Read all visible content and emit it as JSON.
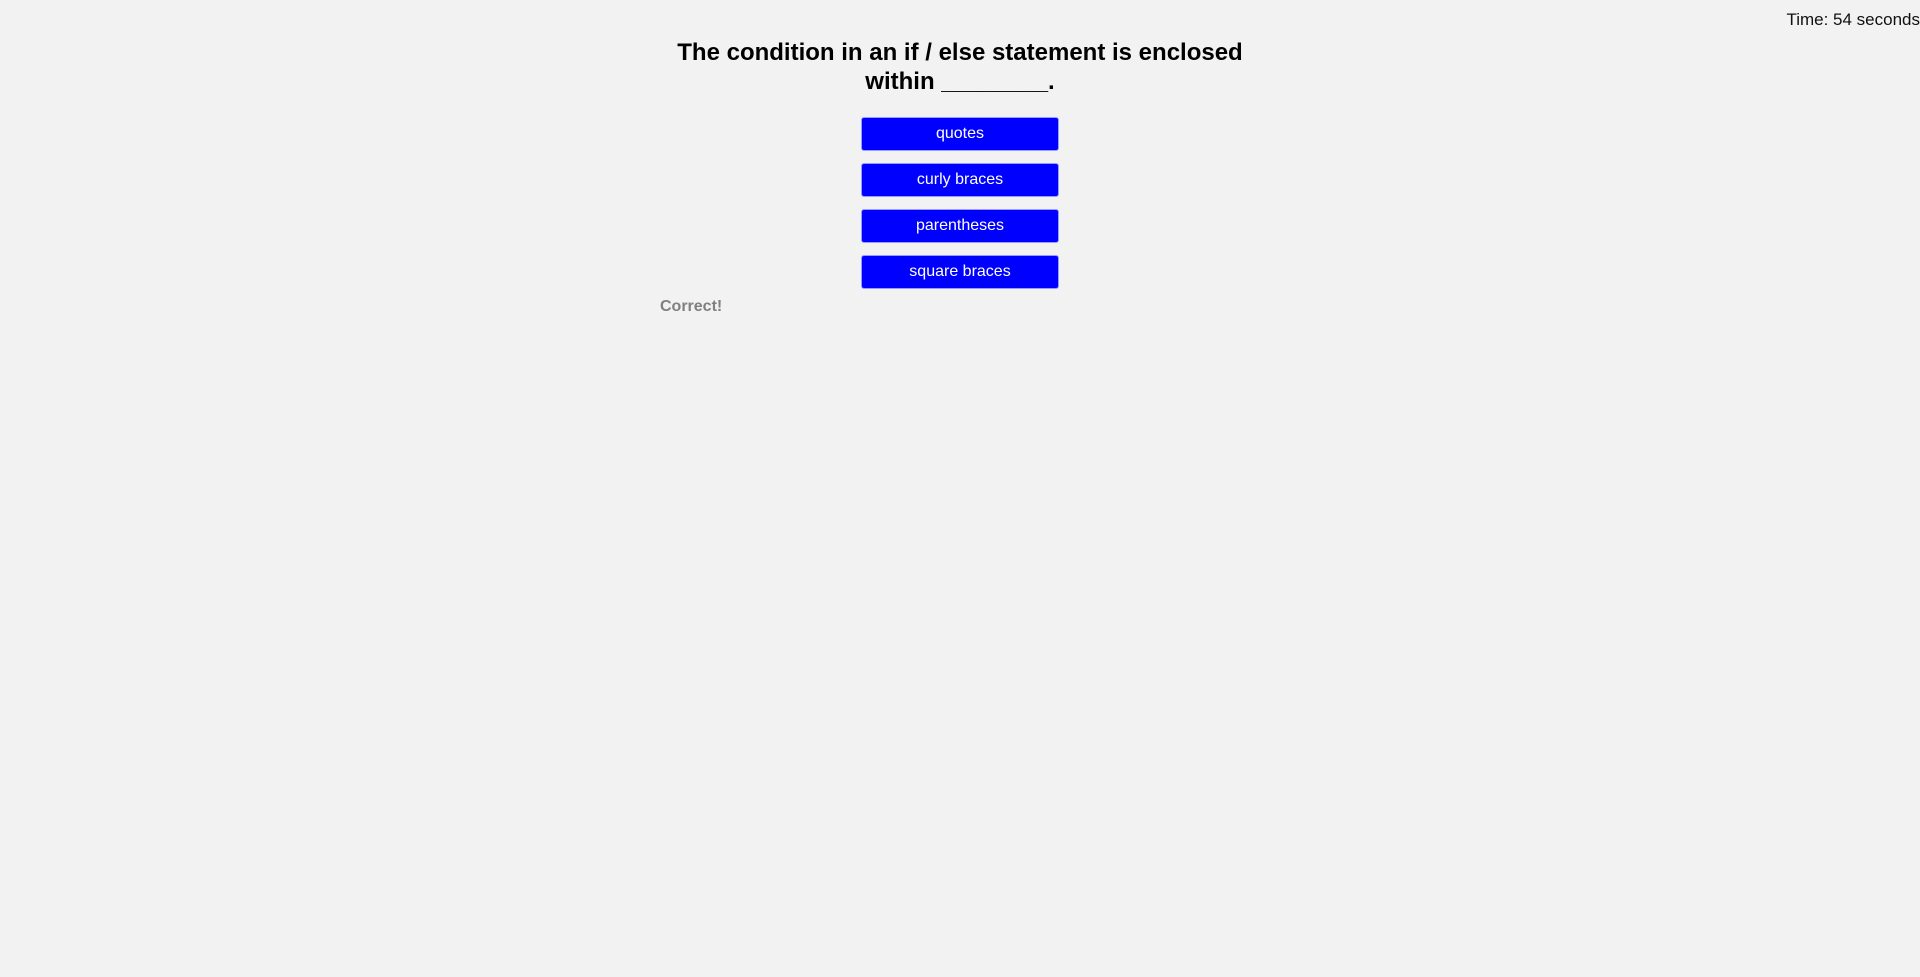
{
  "header": {
    "timer_text": "Time: 54 seconds"
  },
  "quiz": {
    "question": "The condition in an if / else statement is enclosed within ________.",
    "choices": [
      {
        "label": "quotes"
      },
      {
        "label": "curly braces"
      },
      {
        "label": "parentheses"
      },
      {
        "label": "square braces"
      }
    ],
    "feedback": "Correct!"
  },
  "colors": {
    "background": "#f2f2f2",
    "button": "#0000ff",
    "button_text": "#ffffff",
    "feedback_text": "#808080"
  }
}
